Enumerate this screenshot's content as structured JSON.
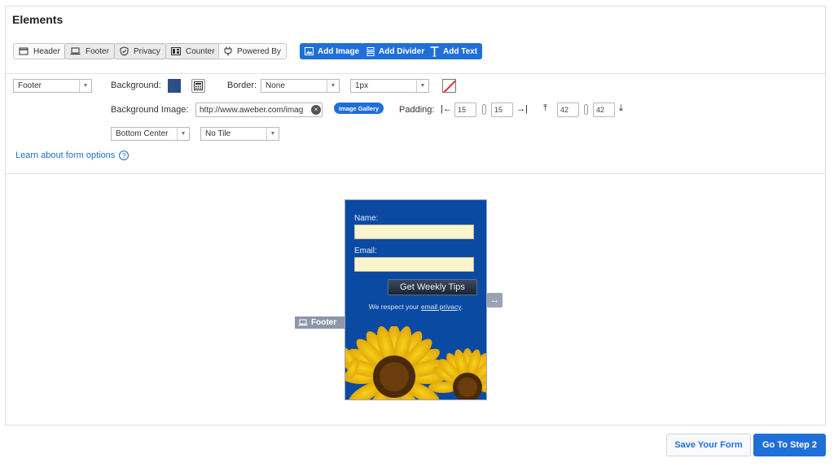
{
  "panel": {
    "title": "Elements"
  },
  "elements": {
    "header": "Header",
    "footer": "Footer",
    "privacy": "Privacy",
    "counter": "Counter",
    "powered_by": "Powered By",
    "add_image": "Add Image",
    "add_divider": "Add Divider",
    "add_text": "Add Text"
  },
  "options": {
    "section_select": "Footer",
    "background_label": "Background:",
    "background_color": "#2b4f86",
    "border_label": "Border:",
    "border_style": "None",
    "border_width": "1px",
    "bg_image_label": "Background Image:",
    "bg_image_url": "http://www.aweber.com/imag",
    "image_gallery": "Image Gallery",
    "padding_label": "Padding:",
    "padding_left": "15",
    "padding_right": "15",
    "padding_top": "42",
    "padding_bottom": "42",
    "bg_position": "Bottom Center",
    "bg_repeat": "No Tile",
    "learn_link": "Learn about form options"
  },
  "preview": {
    "name_label": "Name:",
    "email_label": "Email:",
    "submit_label": "Get Weekly Tips",
    "privacy_prefix": "We respect your ",
    "privacy_link": "email privacy",
    "privacy_suffix": ".",
    "footer_tag": "Footer"
  },
  "actions": {
    "save": "Save Your Form",
    "next": "Go To Step 2"
  },
  "colors": {
    "accent": "#1f6fd8",
    "form_bg": "#0b4aa3",
    "input_bg": "#fbf5cf"
  }
}
